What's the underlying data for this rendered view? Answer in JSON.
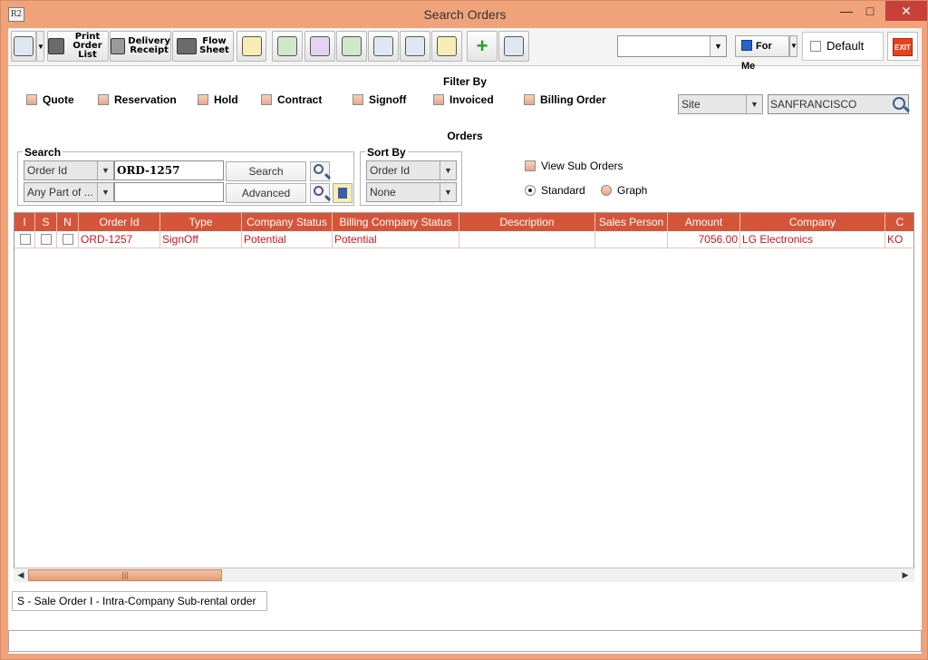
{
  "window": {
    "app_icon_text": "R2",
    "title": "Search Orders",
    "minimize": "—",
    "maximize": "□",
    "close": "✕"
  },
  "toolbar": {
    "print_order_list": [
      "Print",
      "Order List"
    ],
    "delivery_receipt": [
      "Delivery",
      "Receipt"
    ],
    "flow_sheet": [
      "Flow",
      "Sheet"
    ],
    "view_combo_value": "",
    "for_me_label": "For Me",
    "default_label": "Default",
    "exit_label": "EXIT"
  },
  "filter": {
    "heading": "Filter By",
    "options": [
      "Quote",
      "Reservation",
      "Hold",
      "Contract",
      "Signoff",
      "Invoiced",
      "Billing Order"
    ],
    "site_combo": "Site",
    "site_value": "SANFRANCISCO"
  },
  "orders_heading": "Orders",
  "search": {
    "legend": "Search",
    "field_combo": "Order Id",
    "value": "ORD-1257",
    "match_combo": "Any Part of ...",
    "second_value": "",
    "search_button": "Search",
    "advanced_button": "Advanced"
  },
  "sort": {
    "legend": "Sort By",
    "primary": "Order Id",
    "secondary": "None"
  },
  "view_options": {
    "view_sub_orders": "View Sub Orders",
    "standard": "Standard",
    "graph": "Graph",
    "selected": "Standard"
  },
  "table": {
    "columns": [
      "I",
      "S",
      "N",
      "Order Id",
      "Type",
      "Company Status",
      "Billing Company Status",
      "Description",
      "Sales Person",
      "Amount",
      "Company",
      "C"
    ],
    "rows": [
      {
        "order_id": "ORD-1257",
        "type": "SignOff",
        "company_status": "Potential",
        "billing_company_status": "Potential",
        "description": "",
        "sales_person": "",
        "amount": "7056.00",
        "company": "LG Electronics",
        "extra": "KO"
      }
    ]
  },
  "scrollbar": {
    "left": "◀",
    "right": "▶",
    "grip": "|||"
  },
  "legend_text": "S - Sale Order  I - Intra-Company Sub-rental order",
  "status_bar": "",
  "colors": {
    "accent": "#d5553a",
    "row_text": "#d0141e",
    "frame": "#f0a27a"
  }
}
